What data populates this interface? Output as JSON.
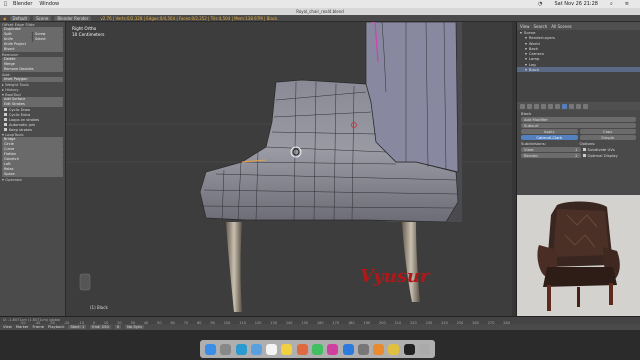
{
  "menubar": {
    "apple": "",
    "app": "Blender",
    "menus": [
      "Window"
    ],
    "clock": "Sat Nov 26  21:28"
  },
  "window_title": "Royal_chair_real4.blend",
  "header": {
    "view": "Default",
    "scene": "Scene",
    "engine": "Blender Render",
    "stats": "v2.76 | Verts:0/2,328 | Edges:0/4,564 | Faces:0/2,252 | Tris:4,504 | Mem:138.97M | Black"
  },
  "toolshelf": {
    "rows": [
      {
        "type": "hdr",
        "text": "Offset Edge Slide"
      },
      {
        "type": "btn",
        "items": [
          "Duplicate"
        ]
      },
      {
        "type": "btn",
        "items": [
          "Split",
          "Screw"
        ]
      },
      {
        "type": "btn",
        "items": [
          "Knife",
          "Select"
        ]
      },
      {
        "type": "btn",
        "items": [
          "Knife Project"
        ]
      },
      {
        "type": "btn",
        "items": [
          "Bisect"
        ]
      },
      {
        "type": "hdr",
        "text": "Remove:"
      },
      {
        "type": "btn",
        "items": [
          "Delete"
        ]
      },
      {
        "type": "btn",
        "items": [
          "Merge"
        ]
      },
      {
        "type": "btn",
        "items": [
          "Remove Doubles"
        ]
      },
      {
        "type": "hdr",
        "text": "Add:"
      },
      {
        "type": "btn",
        "items": [
          "Inset Polygon"
        ]
      },
      {
        "type": "hdr",
        "text": "▸ Weight Tools"
      },
      {
        "type": "hdr",
        "text": "▸ History"
      },
      {
        "type": "hdr",
        "text": "▾ BoolTool"
      },
      {
        "type": "btn",
        "items": [
          "Add Surface"
        ]
      },
      {
        "type": "btn",
        "items": [
          "Edit Strokes"
        ]
      },
      {
        "type": "chk",
        "text": "Cyclic Draw"
      },
      {
        "type": "chk",
        "text": "Cyclic Extra"
      },
      {
        "type": "chk",
        "text": "Loops on strokes"
      },
      {
        "type": "chk",
        "text": "Automatic join"
      },
      {
        "type": "chk",
        "text": "Keep strokes"
      },
      {
        "type": "hdr",
        "text": "▾ LoopTools"
      },
      {
        "type": "btn",
        "items": [
          "Bridge"
        ]
      },
      {
        "type": "btn",
        "items": [
          "Circle"
        ]
      },
      {
        "type": "btn",
        "items": [
          "Curve"
        ]
      },
      {
        "type": "btn",
        "items": [
          "Flatten"
        ]
      },
      {
        "type": "btn",
        "items": [
          "Gstretch"
        ]
      },
      {
        "type": "btn",
        "items": [
          "Loft"
        ]
      },
      {
        "type": "btn",
        "items": [
          "Relax"
        ]
      },
      {
        "type": "btn",
        "items": [
          "Space"
        ]
      },
      {
        "type": "hdr",
        "text": "▾ Operator"
      }
    ]
  },
  "viewport": {
    "view_label": "Right Ortho",
    "unit_label": "10 Centimeters",
    "object_label": "(1) Black",
    "watermark": "Vyusur",
    "cursor_info": "D: -1.8071cm (1.8071cm) global"
  },
  "timeline": {
    "ticks": [
      "-50",
      "-40",
      "-30",
      "-20",
      "-10",
      "0",
      "10",
      "20",
      "30",
      "40",
      "50",
      "60",
      "70",
      "80",
      "90",
      "100",
      "110",
      "120",
      "130",
      "140",
      "150",
      "160",
      "170",
      "180",
      "190",
      "200",
      "210",
      "220",
      "230",
      "240",
      "250",
      "260",
      "270",
      "280"
    ],
    "view": "View",
    "marker": "Marker",
    "frame": "Frame",
    "playback": "Playback",
    "start": "Start:",
    "start_val": "1",
    "end": "End:",
    "end_val": "250",
    "current": "0",
    "sync": "No Sync"
  },
  "outliner": {
    "tabs": [
      "View",
      "Search",
      "All Scenes"
    ],
    "rows": [
      {
        "label": "Scene"
      },
      {
        "label": "RenderLayers"
      },
      {
        "label": "World"
      },
      {
        "label": "Back"
      },
      {
        "label": "Camera"
      },
      {
        "label": "Lamp"
      },
      {
        "label": "Leg"
      },
      {
        "label": "Black"
      }
    ]
  },
  "properties": {
    "object": "Black",
    "add_modifier": "Add Modifier",
    "modifier_name": "Subsurf",
    "apply": "Apply",
    "copy": "Copy",
    "catmull": "Catmull-Clark",
    "simple": "Simple",
    "subdivisions": "Subdivisions:",
    "options": "Options:",
    "view_label": "View:",
    "view_val": "1",
    "render_label": "Render:",
    "render_val": "2",
    "subdivide_uvs": "Subdivide UVs",
    "optimal_display": "Optimal Display"
  },
  "image_editor": {
    "items": [
      "View",
      "Image"
    ],
    "image_name": "Antique_chair.png"
  },
  "colors": {
    "accent": "#5480c0",
    "watermark": "#b01818"
  }
}
